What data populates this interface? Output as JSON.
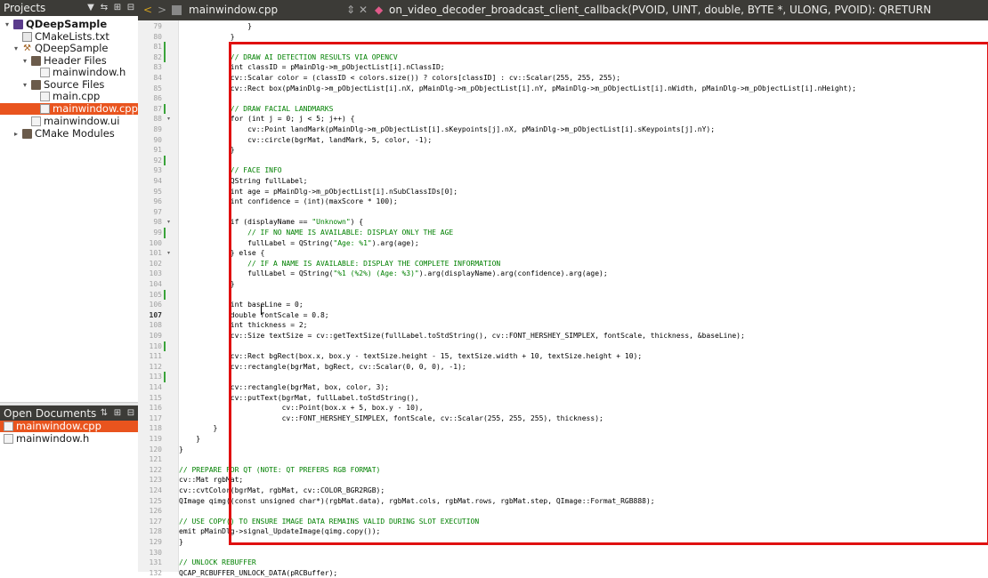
{
  "projects_panel": {
    "title": "Projects",
    "tree": [
      {
        "label": "QDeepSample",
        "depth": 0,
        "icon": "project-icon",
        "expanded": true,
        "bold": true
      },
      {
        "label": "CMakeLists.txt",
        "depth": 1,
        "icon": "cmake-file-icon"
      },
      {
        "label": "QDeepSample",
        "depth": 1,
        "icon": "wrench-icon",
        "expanded": true
      },
      {
        "label": "Header Files",
        "depth": 2,
        "icon": "folder-icon",
        "expanded": true
      },
      {
        "label": "mainwindow.h",
        "depth": 3,
        "icon": "header-file-icon"
      },
      {
        "label": "Source Files",
        "depth": 2,
        "icon": "folder-icon",
        "expanded": true
      },
      {
        "label": "main.cpp",
        "depth": 3,
        "icon": "cpp-file-icon"
      },
      {
        "label": "mainwindow.cpp",
        "depth": 3,
        "icon": "cpp-file-icon",
        "selected": true
      },
      {
        "label": "mainwindow.ui",
        "depth": 2,
        "icon": "ui-file-icon"
      },
      {
        "label": "CMake Modules",
        "depth": 1,
        "icon": "folder-icon",
        "expanded": false
      }
    ]
  },
  "open_documents": {
    "title": "Open Documents",
    "items": [
      {
        "label": "mainwindow.cpp",
        "selected": true
      },
      {
        "label": "mainwindow.h",
        "selected": false
      }
    ]
  },
  "editor_toolbar": {
    "file_name": "mainwindow.cpp",
    "function_name": "on_video_decoder_broadcast_client_callback(PVOID, UINT, double, BYTE *, ULONG, PVOID): QRETURN"
  },
  "colors": {
    "accent": "#e9541e",
    "dark_bar": "#3c3b37",
    "highlight_box": "#e01010",
    "comment": "#008000",
    "type": "#800080"
  },
  "editor": {
    "current_line": "107",
    "lines": [
      {
        "n": "79",
        "t": "                }"
      },
      {
        "n": "80",
        "t": "            }"
      },
      {
        "n": "81",
        "t": ""
      },
      {
        "n": "82",
        "t": "            // DRAW AI DETECTION RESULTS VIA OPENCV"
      },
      {
        "n": "83",
        "t": "            int classID = pMainDlg->m_pObjectList[i].nClassID;"
      },
      {
        "n": "84",
        "t": "            cv::Scalar color = (classID < colors.size()) ? colors[classID] : cv::Scalar(255, 255, 255);"
      },
      {
        "n": "85",
        "t": "            cv::Rect box(pMainDlg->m_pObjectList[i].nX, pMainDlg->m_pObjectList[i].nY, pMainDlg->m_pObjectList[i].nWidth, pMainDlg->m_pObjectList[i].nHeight);"
      },
      {
        "n": "86",
        "t": ""
      },
      {
        "n": "87",
        "t": "            // DRAW FACIAL LANDMARKS"
      },
      {
        "n": "88",
        "t": "            for (int j = 0; j < 5; j++) {"
      },
      {
        "n": "89",
        "t": "                cv::Point landMark(pMainDlg->m_pObjectList[i].sKeypoints[j].nX, pMainDlg->m_pObjectList[i].sKeypoints[j].nY);"
      },
      {
        "n": "90",
        "t": "                cv::circle(bgrMat, landMark, 5, color, -1);"
      },
      {
        "n": "91",
        "t": "            }"
      },
      {
        "n": "92",
        "t": ""
      },
      {
        "n": "93",
        "t": "            // FACE INFO"
      },
      {
        "n": "94",
        "t": "            QString fullLabel;"
      },
      {
        "n": "95",
        "t": "            int age = pMainDlg->m_pObjectList[i].nSubClassIDs[0];"
      },
      {
        "n": "96",
        "t": "            int confidence = (int)(maxScore * 100);"
      },
      {
        "n": "97",
        "t": ""
      },
      {
        "n": "98",
        "t": "            if (displayName == \"Unknown\") {"
      },
      {
        "n": "99",
        "t": "                // IF NO NAME IS AVAILABLE: DISPLAY ONLY THE AGE"
      },
      {
        "n": "100",
        "t": "                fullLabel = QString(\"Age: %1\").arg(age);"
      },
      {
        "n": "101",
        "t": "            } else {"
      },
      {
        "n": "102",
        "t": "                // IF A NAME IS AVAILABLE: DISPLAY THE COMPLETE INFORMATION"
      },
      {
        "n": "103",
        "t": "                fullLabel = QString(\"%1 (%2%) (Age: %3)\").arg(displayName).arg(confidence).arg(age);"
      },
      {
        "n": "104",
        "t": "            }"
      },
      {
        "n": "105",
        "t": ""
      },
      {
        "n": "106",
        "t": "            int baseLine = 0;"
      },
      {
        "n": "107",
        "t": "            double fontScale = 0.8;"
      },
      {
        "n": "108",
        "t": "            int thickness = 2;"
      },
      {
        "n": "109",
        "t": "            cv::Size textSize = cv::getTextSize(fullLabel.toStdString(), cv::FONT_HERSHEY_SIMPLEX, fontScale, thickness, &baseLine);"
      },
      {
        "n": "110",
        "t": ""
      },
      {
        "n": "111",
        "t": "            cv::Rect bgRect(box.x, box.y - textSize.height - 15, textSize.width + 10, textSize.height + 10);"
      },
      {
        "n": "112",
        "t": "            cv::rectangle(bgrMat, bgRect, cv::Scalar(0, 0, 0), -1);"
      },
      {
        "n": "113",
        "t": ""
      },
      {
        "n": "114",
        "t": "            cv::rectangle(bgrMat, box, color, 3);"
      },
      {
        "n": "115",
        "t": "            cv::putText(bgrMat, fullLabel.toStdString(),"
      },
      {
        "n": "116",
        "t": "                        cv::Point(box.x + 5, box.y - 10),"
      },
      {
        "n": "117",
        "t": "                        cv::FONT_HERSHEY_SIMPLEX, fontScale, cv::Scalar(255, 255, 255), thickness);"
      },
      {
        "n": "118",
        "t": "        }"
      },
      {
        "n": "119",
        "t": "    }"
      },
      {
        "n": "120",
        "t": "}"
      },
      {
        "n": "121",
        "t": ""
      },
      {
        "n": "122",
        "t": "// PREPARE FOR QT (NOTE: QT PREFERS RGB FORMAT)"
      },
      {
        "n": "123",
        "t": "cv::Mat rgbMat;"
      },
      {
        "n": "124",
        "t": "cv::cvtColor(bgrMat, rgbMat, cv::COLOR_BGR2RGB);"
      },
      {
        "n": "125",
        "t": "QImage qimg((const unsigned char*)(rgbMat.data), rgbMat.cols, rgbMat.rows, rgbMat.step, QImage::Format_RGB888);"
      },
      {
        "n": "126",
        "t": ""
      },
      {
        "n": "127",
        "t": "// USE COPY() TO ENSURE IMAGE DATA REMAINS VALID DURING SLOT EXECUTION"
      },
      {
        "n": "128",
        "t": "emit pMainDlg->signal_UpdateImage(qimg.copy());"
      },
      {
        "n": "129",
        "t": "}"
      },
      {
        "n": "130",
        "t": ""
      },
      {
        "n": "131",
        "t": "// UNLOCK REBUFFER"
      },
      {
        "n": "132",
        "t": "QCAP_RCBUFFER_UNLOCK_DATA(pRCBuffer);"
      }
    ]
  }
}
